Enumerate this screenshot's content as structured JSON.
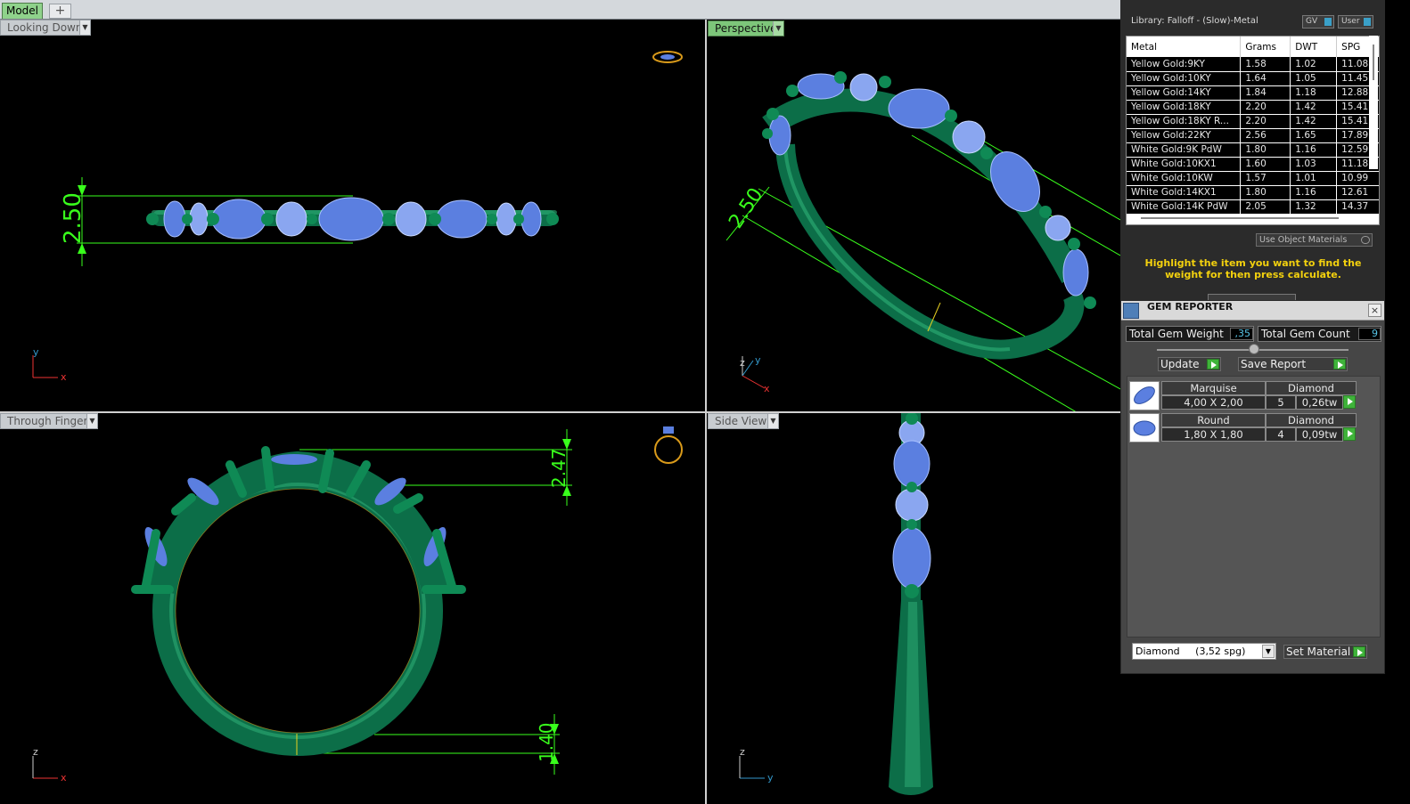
{
  "tabs": {
    "model": "Model",
    "add": "+"
  },
  "viewports": {
    "looking_down": {
      "label": "Looking Down",
      "dimension": "2.50",
      "axis_h": "x",
      "axis_v": "y"
    },
    "perspective": {
      "label": "Perspective",
      "dimension": "2.50",
      "axis_h": "x",
      "axis_v": "y",
      "axis_z": "z"
    },
    "through_finger": {
      "label": "Through Finger",
      "dimension_top": "2.47",
      "dimension_bottom": "1.40",
      "axis_h": "x",
      "axis_v": "z"
    },
    "side_view": {
      "label": "Side View",
      "axis_h": "y",
      "axis_v": "z"
    }
  },
  "metal_panel": {
    "library": "Library: Falloff - (Slow)-Metal",
    "gv_label": "GV",
    "user_label": "User",
    "columns": [
      "Metal",
      "Grams",
      "DWT",
      "SPG"
    ],
    "rows": [
      [
        "Yellow Gold:9KY",
        "1.58",
        "1.02",
        "11.08"
      ],
      [
        "Yellow Gold:10KY",
        "1.64",
        "1.05",
        "11.45"
      ],
      [
        "Yellow Gold:14KY",
        "1.84",
        "1.18",
        "12.88"
      ],
      [
        "Yellow Gold:18KY",
        "2.20",
        "1.42",
        "15.41"
      ],
      [
        "Yellow Gold:18KY R...",
        "2.20",
        "1.42",
        "15.41"
      ],
      [
        "Yellow Gold:22KY",
        "2.56",
        "1.65",
        "17.89"
      ],
      [
        "White Gold:9K PdW",
        "1.80",
        "1.16",
        "12.59"
      ],
      [
        "White Gold:10KX1",
        "1.60",
        "1.03",
        "11.18"
      ],
      [
        "White Gold:10KW",
        "1.57",
        "1.01",
        "10.99"
      ],
      [
        "White Gold:14KX1",
        "1.80",
        "1.16",
        "12.61"
      ],
      [
        "White Gold:14K PdW",
        "2.05",
        "1.32",
        "14.37"
      ]
    ],
    "use_object_materials": "Use Object Materials",
    "hint": "Highlight the item you want to find the weight for then press calculate."
  },
  "gem_reporter": {
    "title": "GEM REPORTER",
    "close": "×",
    "total_weight_label": "Total Gem Weight",
    "total_weight": ",35",
    "total_count_label": "Total Gem Count",
    "total_count": "9",
    "update": "Update",
    "save_report": "Save Report",
    "gems": [
      {
        "shape": "Marquise",
        "size": "4,00 X 2,00",
        "material": "Diamond",
        "count": "5",
        "weight": "0,26tw"
      },
      {
        "shape": "Round",
        "size": "1,80 X 1,80",
        "material": "Diamond",
        "count": "4",
        "weight": "0,09tw"
      }
    ],
    "material_select": "Diamond     (3,52 spg)",
    "set_material": "Set Material"
  },
  "colors": {
    "band": "#0c6e48",
    "gem": "#5b7fe0",
    "dimension": "#39ff1c",
    "active_tab": "#7dc67a",
    "hint": "#f3d10e"
  }
}
